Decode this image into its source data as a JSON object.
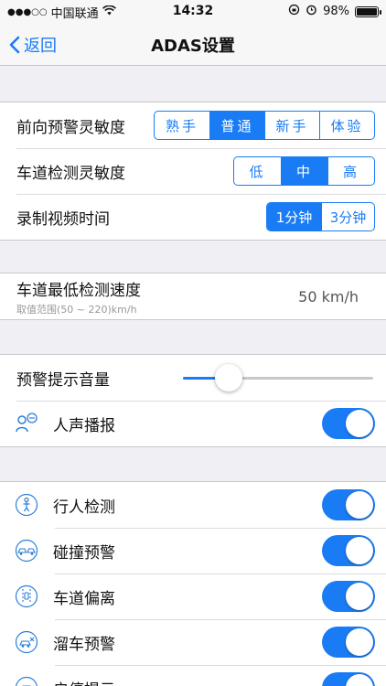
{
  "status": {
    "carrier": "中国联通",
    "time": "14:32",
    "battery": "98%",
    "battery_level": 0.98,
    "signal_dots": "●●●○○"
  },
  "nav": {
    "back_label": "返回",
    "title": "ADAS设置"
  },
  "sensitivity": {
    "forward_label": "前向预警灵敏度",
    "forward_options": [
      "熟手",
      "普通",
      "新手",
      "体验"
    ],
    "forward_selected": 1,
    "lane_label": "车道检测灵敏度",
    "lane_options": [
      "低",
      "中",
      "高"
    ],
    "lane_selected": 1,
    "record_label": "录制视频时间",
    "record_options": [
      "1分钟",
      "3分钟"
    ],
    "record_selected": 0
  },
  "speed": {
    "label": "车道最低检测速度",
    "range_hint": "取值范围(50 ~ 220)km/h",
    "value": "50 km/h"
  },
  "volume": {
    "label": "预警提示音量",
    "level": 0.24,
    "voice_label": "人声播报",
    "voice_on": true
  },
  "features": [
    {
      "label": "行人检测",
      "icon": "pedestrian-icon",
      "on": true
    },
    {
      "label": "碰撞预警",
      "icon": "collision-icon",
      "on": true
    },
    {
      "label": "车道偏离",
      "icon": "lane-departure-icon",
      "on": true
    },
    {
      "label": "溜车预警",
      "icon": "rolling-car-icon",
      "on": true
    },
    {
      "label": "启停提示",
      "icon": "start-stop-icon",
      "on": true
    }
  ],
  "colors": {
    "accent": "#1a7cf4",
    "background": "#efeff4"
  }
}
